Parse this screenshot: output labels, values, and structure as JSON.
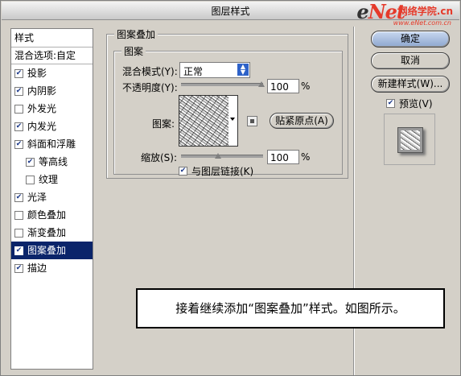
{
  "dialog": {
    "title": "图层样式"
  },
  "watermark": {
    "brand_e": "e",
    "brand_net": "Net",
    "brand_cn": "网络学院",
    "brand_tld": ".cn",
    "url": "www.eNet.com.cn"
  },
  "styles": {
    "header": "样式",
    "blend_options": "混合选项:自定",
    "items": [
      {
        "label": "投影",
        "checked": true
      },
      {
        "label": "内阴影",
        "checked": true
      },
      {
        "label": "外发光",
        "checked": false
      },
      {
        "label": "内发光",
        "checked": true
      },
      {
        "label": "斜面和浮雕",
        "checked": true
      },
      {
        "label": "等高线",
        "checked": true
      },
      {
        "label": "纹理",
        "checked": false
      },
      {
        "label": "光泽",
        "checked": true
      },
      {
        "label": "颜色叠加",
        "checked": false
      },
      {
        "label": "渐变叠加",
        "checked": false
      },
      {
        "label": "图案叠加",
        "checked": true,
        "selected": true
      },
      {
        "label": "描边",
        "checked": true
      }
    ]
  },
  "panel": {
    "group_title": "图案叠加",
    "inner_title": "图案",
    "blend_mode_label": "混合模式(Y):",
    "blend_mode_value": "正常",
    "opacity_label": "不透明度(Y):",
    "opacity_value": "100",
    "opacity_unit": "%",
    "opacity_fraction": 1.0,
    "pattern_label": "图案:",
    "snap_origin_button": "贴紧原点(A)",
    "scale_label": "缩放(S):",
    "scale_value": "100",
    "scale_unit": "%",
    "link_label": "与图层链接(K)",
    "link_checked": true
  },
  "buttons": {
    "ok": "确定",
    "cancel": "取消",
    "new_style": "新建样式(W)...",
    "preview_label": "预览(V)",
    "preview_checked": true
  },
  "note": {
    "text": "接着继续添加“图案叠加”样式。如图所示。"
  }
}
